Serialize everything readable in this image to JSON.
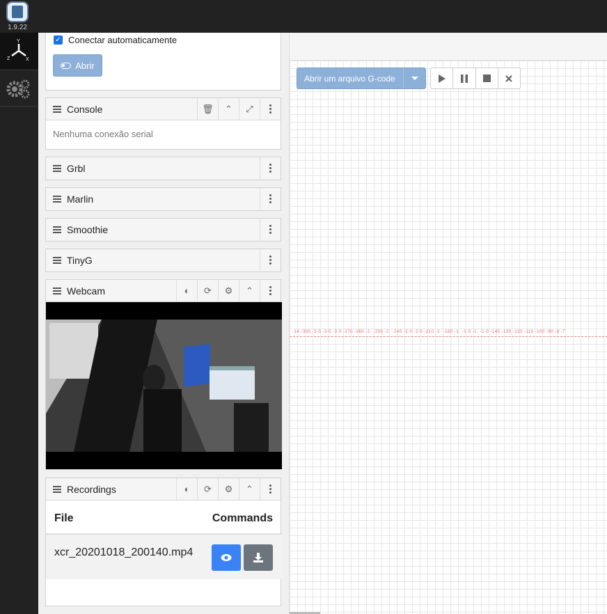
{
  "app": {
    "version": "1.9.22"
  },
  "connection": {
    "auto_connect_label": "Conectar automaticamente",
    "open_button": "Abrir"
  },
  "console": {
    "title": "Console",
    "message": "Nenhuma conexão serial"
  },
  "widgets": {
    "grbl": "Grbl",
    "marlin": "Marlin",
    "smoothie": "Smoothie",
    "tinyg": "TinyG",
    "webcam": "Webcam"
  },
  "recordings": {
    "title": "Recordings",
    "col_file": "File",
    "col_commands": "Commands",
    "rows": [
      {
        "file": "xcr_20201018_200140.mp4"
      }
    ]
  },
  "visualizer": {
    "open_gcode": "Abrir um arquivo G-code",
    "x_ticks": "-14 -330 -3·0 -3·0 -3·0 -270 -260 -2· -250 -2· -240 -2·0 -2·0 -210 -2· -180 -1· -1·0 -1· -1·0 -140 -130 -120 -110 -100 -90 -8 -7"
  },
  "axes": {
    "y": "Y",
    "z": "Z",
    "x": "X"
  }
}
